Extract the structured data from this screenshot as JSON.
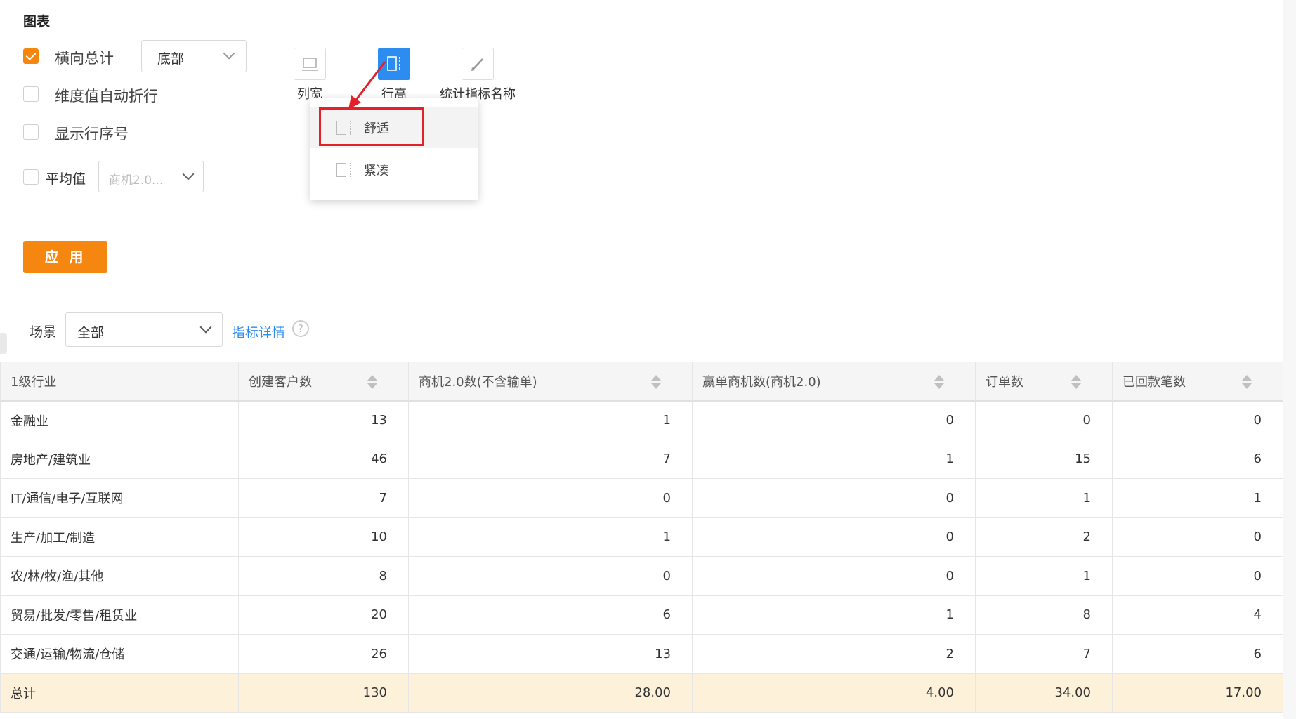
{
  "settings": {
    "section_title": "图表",
    "options": {
      "horizontal_total": {
        "label": "横向总计",
        "checked": true,
        "position_value": "底部"
      },
      "auto_wrap": {
        "label": "维度值自动折行",
        "checked": false
      },
      "row_number": {
        "label": "显示行序号",
        "checked": false
      },
      "average": {
        "label": "平均值",
        "checked": false,
        "metric_value": "商机2.0..."
      }
    },
    "tools": {
      "col_width": "列宽",
      "row_height": "行高",
      "metric_name": "统计指标名称"
    },
    "row_height_menu": {
      "comfortable": "舒适",
      "compact": "紧凑"
    },
    "apply_label": "应 用"
  },
  "filter": {
    "scene_label": "场景",
    "scene_value": "全部",
    "metric_detail_link": "指标详情",
    "help_glyph": "?"
  },
  "table": {
    "headers": [
      "1级行业",
      "创建客户数",
      "商机2.0数(不含输单)",
      "赢单商机数(商机2.0)",
      "订单数",
      "已回款笔数"
    ],
    "rows": [
      [
        "金融业",
        "13",
        "1",
        "0",
        "0",
        "0"
      ],
      [
        "房地产/建筑业",
        "46",
        "7",
        "1",
        "15",
        "6"
      ],
      [
        "IT/通信/电子/互联网",
        "7",
        "0",
        "0",
        "1",
        "1"
      ],
      [
        "生产/加工/制造",
        "10",
        "1",
        "0",
        "2",
        "0"
      ],
      [
        "农/林/牧/渔/其他",
        "8",
        "0",
        "0",
        "1",
        "0"
      ],
      [
        "贸易/批发/零售/租赁业",
        "20",
        "6",
        "1",
        "8",
        "4"
      ],
      [
        "交通/运输/物流/仓储",
        "26",
        "13",
        "2",
        "7",
        "6"
      ]
    ],
    "total": [
      "总计",
      "130",
      "28.00",
      "4.00",
      "34.00",
      "17.00"
    ]
  },
  "colors": {
    "accent": "#f5860f",
    "primary_blue": "#2d8cf0",
    "highlight_red": "#e4202a",
    "total_row_bg": "#fdf2d9"
  }
}
